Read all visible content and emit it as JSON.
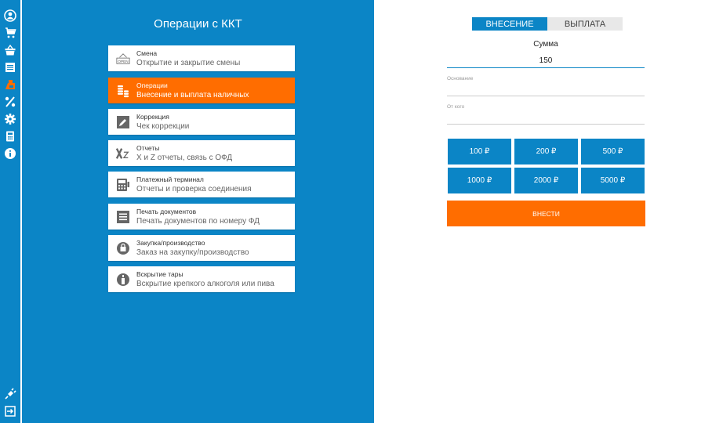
{
  "left_panel": {
    "title": "Операции с ККТ",
    "items": [
      {
        "title": "Смена",
        "subtitle": "Открытие и закрытие смены",
        "icon": "open-sign-icon"
      },
      {
        "title": "Операции",
        "subtitle": "Внесение и выплата наличных",
        "icon": "coins-icon",
        "active": true
      },
      {
        "title": "Коррекция",
        "subtitle": "Чек коррекции",
        "icon": "pencil-icon"
      },
      {
        "title": "Отчеты",
        "subtitle": "X и Z отчеты, связь с ОФД",
        "icon": "xz-icon"
      },
      {
        "title": "Платежный терминал",
        "subtitle": "Отчеты и проверка соединения",
        "icon": "terminal-icon"
      },
      {
        "title": "Печать документов",
        "subtitle": "Печать документов по номеру ФД",
        "icon": "document-icon"
      },
      {
        "title": "Закупка/производство",
        "subtitle": "Заказ на закупку/производство",
        "icon": "bag-icon"
      },
      {
        "title": "Вскрытие тары",
        "subtitle": "Вскрытие крепкого алкоголя или пива",
        "icon": "bottle-icon"
      }
    ]
  },
  "form": {
    "tabs": [
      {
        "label": "ВНЕСЕНИЕ",
        "active": true
      },
      {
        "label": "ВЫПЛАТА",
        "active": false
      }
    ],
    "sum_label": "Сумма",
    "sum_value": "150",
    "reason_label": "Основание",
    "from_label": "От кого",
    "amounts": [
      "100 ₽",
      "200 ₽",
      "500 ₽",
      "1000 ₽",
      "2000 ₽",
      "5000 ₽"
    ],
    "submit_label": "ВНЕСТИ"
  },
  "open_sign_text": "OPEN",
  "colors": {
    "primary": "#0b85c6",
    "accent": "#ff6d00"
  }
}
